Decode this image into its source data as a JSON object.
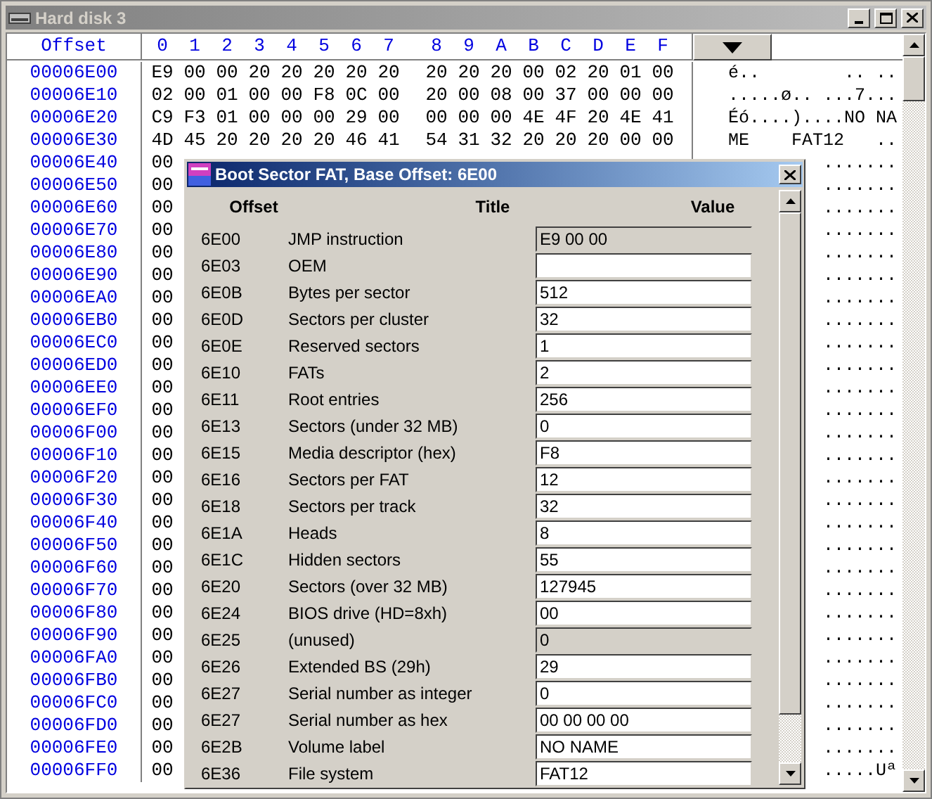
{
  "window": {
    "title": "Hard disk 3"
  },
  "hex_view": {
    "offset_header": "Offset",
    "column_headers": [
      "0",
      "1",
      "2",
      "3",
      "4",
      "5",
      "6",
      "7",
      "8",
      "9",
      "A",
      "B",
      "C",
      "D",
      "E",
      "F"
    ],
    "rows": [
      {
        "offset": "00006E00",
        "bytes": [
          "E9",
          "00",
          "00",
          "20",
          "20",
          "20",
          "20",
          "20",
          "20",
          "20",
          "20",
          "00",
          "02",
          "20",
          "01",
          "00"
        ],
        "text": "é..        .. .."
      },
      {
        "offset": "00006E10",
        "bytes": [
          "02",
          "00",
          "01",
          "00",
          "00",
          "F8",
          "0C",
          "00",
          "20",
          "00",
          "08",
          "00",
          "37",
          "00",
          "00",
          "00"
        ],
        "text": ".....ø.. ...7..."
      },
      {
        "offset": "00006E20",
        "bytes": [
          "C9",
          "F3",
          "01",
          "00",
          "00",
          "00",
          "29",
          "00",
          "00",
          "00",
          "00",
          "4E",
          "4F",
          "20",
          "4E",
          "41"
        ],
        "text": "Éó....)....NO NA"
      },
      {
        "offset": "00006E30",
        "bytes": [
          "4D",
          "45",
          "20",
          "20",
          "20",
          "20",
          "46",
          "41",
          "54",
          "31",
          "32",
          "20",
          "20",
          "20",
          "00",
          "00"
        ],
        "text": "ME    FAT12   .."
      },
      {
        "offset": "00006E40",
        "bytes": [
          "00"
        ],
        "text": "......."
      },
      {
        "offset": "00006E50",
        "bytes": [
          "00"
        ],
        "text": "......."
      },
      {
        "offset": "00006E60",
        "bytes": [
          "00"
        ],
        "text": "......."
      },
      {
        "offset": "00006E70",
        "bytes": [
          "00"
        ],
        "text": "......."
      },
      {
        "offset": "00006E80",
        "bytes": [
          "00"
        ],
        "text": "......."
      },
      {
        "offset": "00006E90",
        "bytes": [
          "00"
        ],
        "text": "......."
      },
      {
        "offset": "00006EA0",
        "bytes": [
          "00"
        ],
        "text": "......."
      },
      {
        "offset": "00006EB0",
        "bytes": [
          "00"
        ],
        "text": "......."
      },
      {
        "offset": "00006EC0",
        "bytes": [
          "00"
        ],
        "text": "......."
      },
      {
        "offset": "00006ED0",
        "bytes": [
          "00"
        ],
        "text": "......."
      },
      {
        "offset": "00006EE0",
        "bytes": [
          "00"
        ],
        "text": "......."
      },
      {
        "offset": "00006EF0",
        "bytes": [
          "00"
        ],
        "text": "......."
      },
      {
        "offset": "00006F00",
        "bytes": [
          "00"
        ],
        "text": "......."
      },
      {
        "offset": "00006F10",
        "bytes": [
          "00"
        ],
        "text": "......."
      },
      {
        "offset": "00006F20",
        "bytes": [
          "00"
        ],
        "text": "......."
      },
      {
        "offset": "00006F30",
        "bytes": [
          "00"
        ],
        "text": "......."
      },
      {
        "offset": "00006F40",
        "bytes": [
          "00"
        ],
        "text": "......."
      },
      {
        "offset": "00006F50",
        "bytes": [
          "00"
        ],
        "text": "......."
      },
      {
        "offset": "00006F60",
        "bytes": [
          "00"
        ],
        "text": "......."
      },
      {
        "offset": "00006F70",
        "bytes": [
          "00"
        ],
        "text": "......."
      },
      {
        "offset": "00006F80",
        "bytes": [
          "00"
        ],
        "text": "......."
      },
      {
        "offset": "00006F90",
        "bytes": [
          "00"
        ],
        "text": "......."
      },
      {
        "offset": "00006FA0",
        "bytes": [
          "00"
        ],
        "text": "......."
      },
      {
        "offset": "00006FB0",
        "bytes": [
          "00"
        ],
        "text": "......."
      },
      {
        "offset": "00006FC0",
        "bytes": [
          "00"
        ],
        "text": "......."
      },
      {
        "offset": "00006FD0",
        "bytes": [
          "00"
        ],
        "text": "......."
      },
      {
        "offset": "00006FE0",
        "bytes": [
          "00"
        ],
        "text": "......."
      },
      {
        "offset": "00006FF0",
        "bytes": [
          "00"
        ],
        "text": ".....Uª"
      }
    ]
  },
  "dialog": {
    "title": "Boot Sector FAT, Base Offset: 6E00",
    "columns": [
      "Offset",
      "Title",
      "Value"
    ],
    "fields": [
      {
        "offset": "6E00",
        "title": "JMP instruction",
        "value": "E9 00 00",
        "readonly": true
      },
      {
        "offset": "6E03",
        "title": "OEM",
        "readonly": false
      },
      {
        "offset": "6E0B",
        "title": "Bytes per sector",
        "value": "512",
        "readonly": false
      },
      {
        "offset": "6E0D",
        "title": "Sectors per cluster",
        "value": "32",
        "readonly": false
      },
      {
        "offset": "6E0E",
        "title": "Reserved sectors",
        "value": "1",
        "readonly": false
      },
      {
        "offset": "6E10",
        "title": "FATs",
        "value": "2",
        "readonly": false
      },
      {
        "offset": "6E11",
        "title": "Root entries",
        "value": "256",
        "readonly": false
      },
      {
        "offset": "6E13",
        "title": "Sectors (under 32 MB)",
        "value": "0",
        "readonly": false
      },
      {
        "offset": "6E15",
        "title": "Media descriptor (hex)",
        "value": "F8",
        "readonly": false
      },
      {
        "offset": "6E16",
        "title": "Sectors per FAT",
        "value": "12",
        "readonly": false
      },
      {
        "offset": "6E18",
        "title": "Sectors per track",
        "value": "32",
        "readonly": false
      },
      {
        "offset": "6E1A",
        "title": "Heads",
        "value": "8",
        "readonly": false
      },
      {
        "offset": "6E1C",
        "title": "Hidden sectors",
        "value": "55",
        "readonly": false
      },
      {
        "offset": "6E20",
        "title": "Sectors (over 32 MB)",
        "value": "127945",
        "readonly": false
      },
      {
        "offset": "6E24",
        "title": "BIOS drive (HD=8xh)",
        "value": "00",
        "readonly": false
      },
      {
        "offset": "6E25",
        "title": "(unused)",
        "value": "0",
        "readonly": true
      },
      {
        "offset": "6E26",
        "title": "Extended BS (29h)",
        "value": "29",
        "readonly": false
      },
      {
        "offset": "6E27",
        "title": "Serial number as integer",
        "value": "0",
        "readonly": false
      },
      {
        "offset": "6E27",
        "title": "Serial number as hex",
        "value": "00 00 00 00",
        "readonly": false
      },
      {
        "offset": "6E2B",
        "title": "Volume label",
        "value": "NO NAME",
        "readonly": false
      },
      {
        "offset": "6E36",
        "title": "File system",
        "value": "FAT12",
        "readonly": false
      }
    ]
  }
}
